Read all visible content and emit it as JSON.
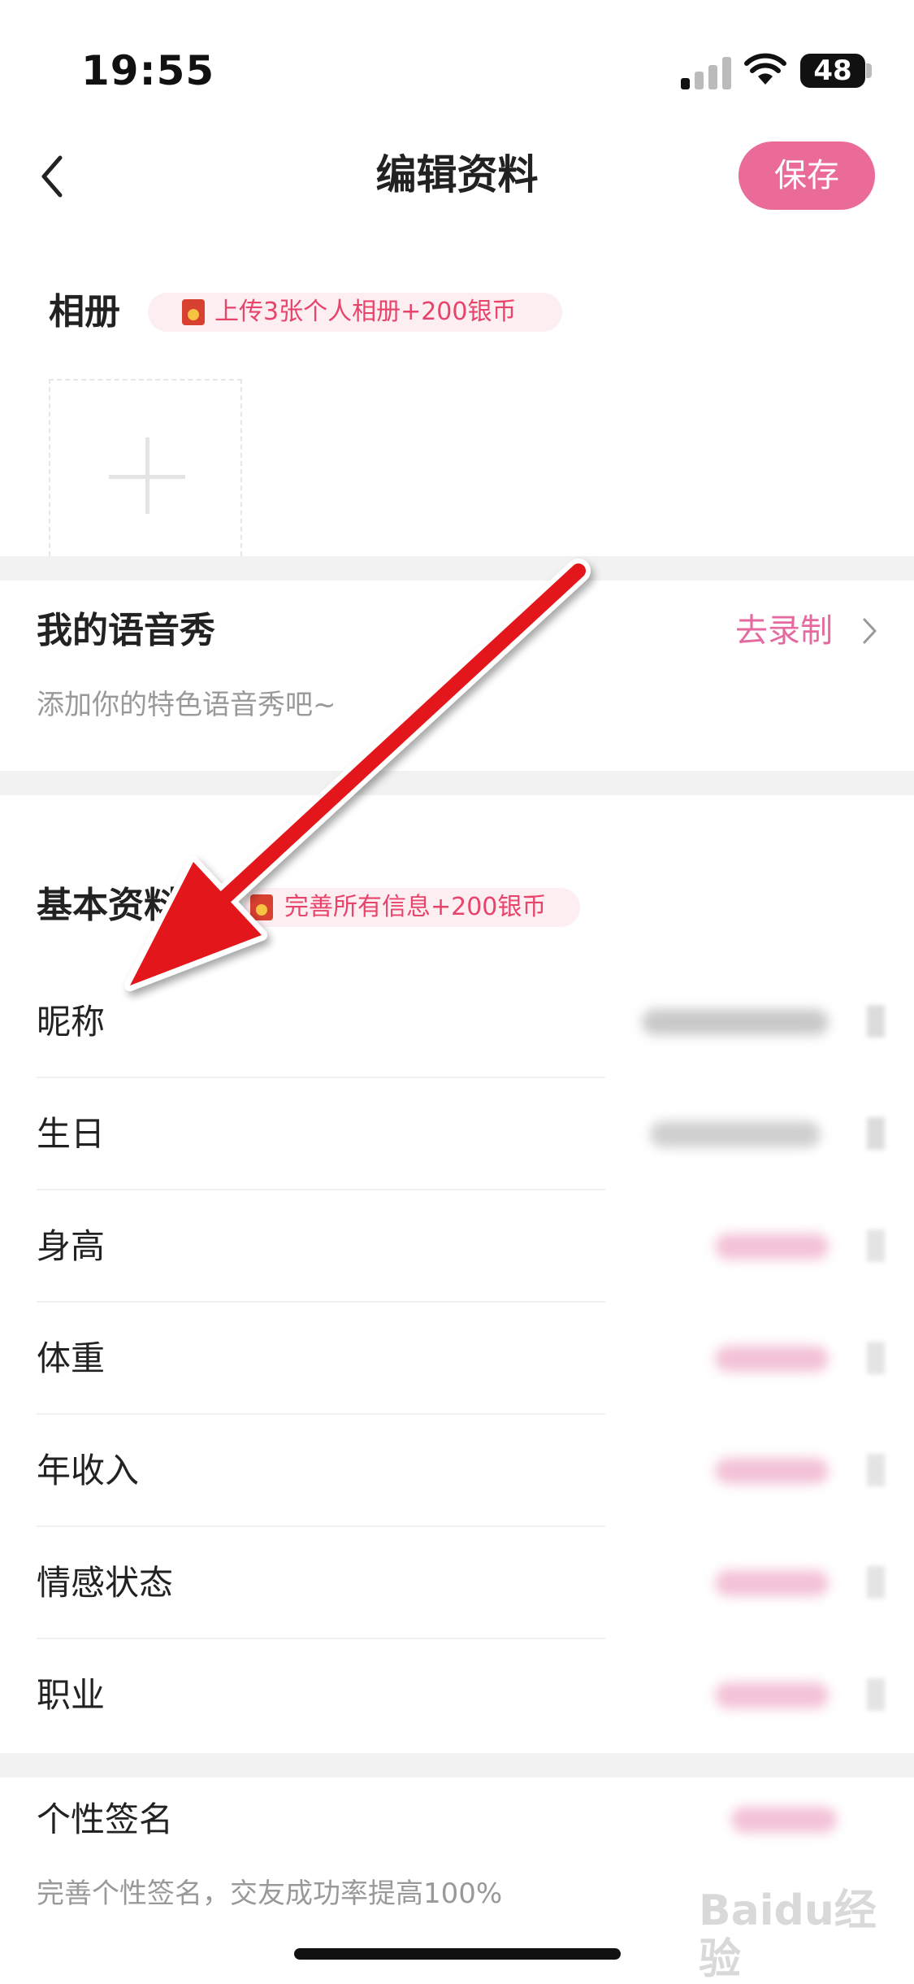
{
  "status_bar": {
    "time": "19:55",
    "battery": "48"
  },
  "nav": {
    "title": "编辑资料",
    "save_label": "保存"
  },
  "album": {
    "title": "相册",
    "promo": "上传3张个人相册+200银币"
  },
  "voice": {
    "title": "我的语音秀",
    "action": "去录制",
    "subtitle": "添加你的特色语音秀吧~"
  },
  "basic_info": {
    "title": "基本资料",
    "promo": "完善所有信息+200银币",
    "rows": [
      {
        "label": "昵称"
      },
      {
        "label": "生日"
      },
      {
        "label": "身高"
      },
      {
        "label": "体重"
      },
      {
        "label": "年收入"
      },
      {
        "label": "情感状态"
      },
      {
        "label": "职业"
      }
    ]
  },
  "signature": {
    "title": "个性签名",
    "subtitle": "完善个性签名，交友成功率提高100%"
  },
  "watermark": "Baidu经验",
  "colors": {
    "accent_pink": "#ea6a9a",
    "promo_text": "#e8446b",
    "arrow": "#e3191b"
  }
}
